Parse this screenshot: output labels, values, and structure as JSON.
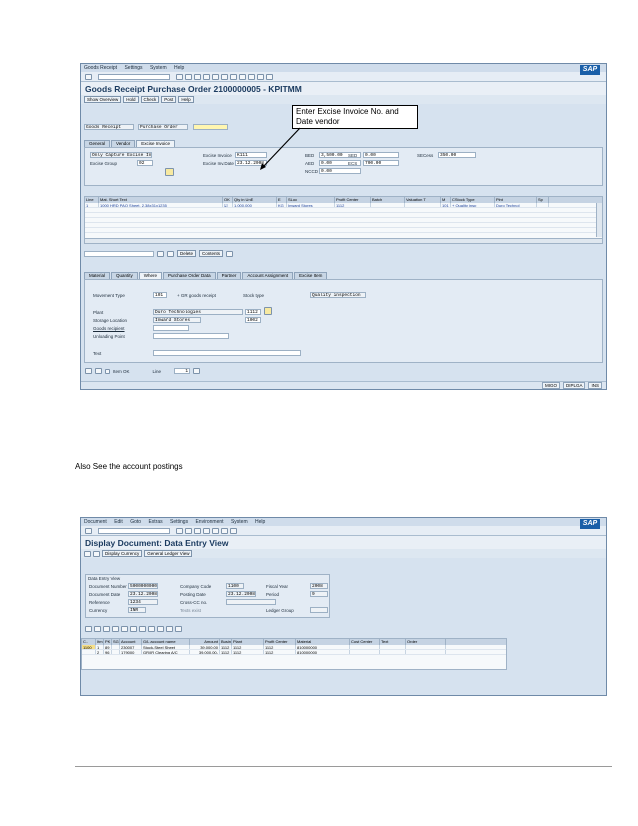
{
  "shot1": {
    "menu": [
      "Goods Receipt",
      "Settings",
      "System",
      "Help"
    ],
    "title": "Goods Receipt Purchase Order 2100000005 - KPITMM",
    "app_buttons": [
      "Show Overview",
      "Hold",
      "Check",
      "Post",
      "Help"
    ],
    "header": {
      "action": "Goods Receipt",
      "reference": "Purchase Order"
    },
    "main_tabs": [
      "General",
      "Vendor",
      "Excise Invoice"
    ],
    "excise": {
      "capture_mode": "Only Capture Excise Invoice",
      "invoice_label": "Excise Invoice",
      "invoice_value": "K111",
      "group_label": "Excise Group",
      "group_value": "02",
      "date_label": "Excise Inv.Date",
      "date_value": "23.12.2008",
      "bed_label": "BED",
      "bed_value": "3,500.00",
      "aed_label": "AED",
      "aed_value": "0.00",
      "nccd_label": "NCCD",
      "nccd_value": "0.00",
      "sed_label": "SED",
      "sed_value": "0.00",
      "ecs_label": "ECS",
      "ecs_value": "700.00",
      "secess_label": "SECess",
      "secess_value": "350.00"
    },
    "grid_columns": [
      "Line",
      "Mat. Short Text",
      "OK",
      "Qty in UnE",
      "E",
      "SLoc",
      "Profit Center",
      "Batch",
      "Valuation T",
      "M",
      "CStock Type",
      "Plnt",
      "Sp"
    ],
    "grid_rows": [
      [
        "1",
        "1000 HRD PAO Sheet, 2.38x31x1235",
        "☑",
        "1,000.000",
        "KG",
        "Inward Stores",
        "1112",
        "",
        "",
        "101",
        "+ Quality insp",
        "Duro Technol",
        ""
      ]
    ],
    "detail_buttons": [
      "Delete",
      "Contents"
    ],
    "detail_tabs": [
      "Material",
      "Quantity",
      "Where",
      "Purchase Order Data",
      "Partner",
      "Account Assignment",
      "Excise Item"
    ],
    "detail": {
      "movement_label": "Movement Type",
      "movement_value": "101",
      "movement_text": "+ GR goods receipt",
      "stock_label": "Stock type",
      "stock_value": "Quality inspection",
      "plant_label": "Plant",
      "plant_value": "Duro Technologies",
      "plant_code": "1112",
      "sloc_label": "Storage Location",
      "sloc_value": "Inward Stores",
      "sloc_code": "1002",
      "recipient_label": "Goods recipient",
      "unloading_label": "Unloading Point",
      "text_label": "Text"
    },
    "footer": {
      "item_ok": "Item OK",
      "line_label": "Line",
      "line_value": "1"
    },
    "status": [
      "MIGO",
      "DIPLGA",
      "INS"
    ]
  },
  "callout": "Enter Excise Invoice No. and Date vendor",
  "caption": "Also See the account postings",
  "shot2": {
    "menu": [
      "Document",
      "Edit",
      "Goto",
      "Extras",
      "Settings",
      "Environment",
      "System",
      "Help"
    ],
    "title": "Display Document: Data Entry View",
    "app_buttons": [
      "Display Currency",
      "General Ledger View"
    ],
    "section_title": "Data Entry View",
    "doc": {
      "docnum_label": "Document Number",
      "docnum_value": "5000000000",
      "company_label": "Company Code",
      "company_value": "1100",
      "fy_label": "Fiscal Year",
      "fy_value": "2008",
      "docdate_label": "Document Date",
      "docdate_value": "23.12.2008",
      "postdate_label": "Posting Date",
      "postdate_value": "23.12.2008",
      "period_label": "Period",
      "period_value": "9",
      "ref_label": "Reference",
      "ref_value": "1234",
      "crosscc_label": "Cross-CC no.",
      "currency_label": "Currency",
      "currency_value": "INR",
      "texts_label": "Texts exist",
      "ledger_label": "Ledger Group"
    },
    "columns": [
      "C..",
      "Itm",
      "PK",
      "SG",
      "Account",
      "G/L account name",
      "Amount",
      "Busin",
      "Plant",
      "Profit Center",
      "Material",
      "Cost Center",
      "Text",
      "Order"
    ],
    "rows": [
      [
        "1100",
        "1",
        "89",
        "",
        "230007",
        "Stock-Steel Sheet",
        "39,000.00",
        "1112",
        "1112",
        "1112",
        "810000000",
        "",
        "",
        ""
      ],
      [
        "",
        "2",
        "96",
        "",
        "179000",
        "GR/IR Clearing A/C",
        "39,000.00-",
        "1112",
        "1112",
        "1112",
        "810000000",
        "",
        "",
        ""
      ]
    ]
  },
  "logo": "SAP"
}
